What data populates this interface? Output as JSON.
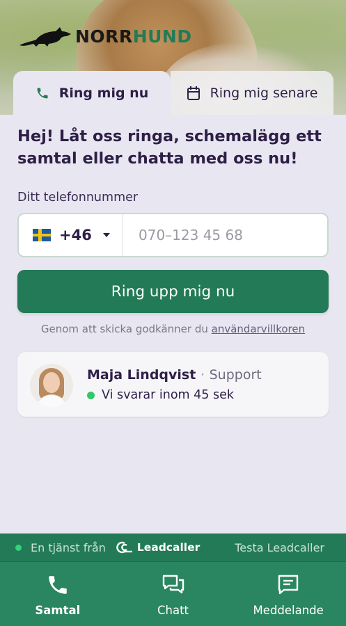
{
  "brand": {
    "name_part1": "NORR",
    "name_part2": "HUND",
    "logo_icon": "fox-icon"
  },
  "tabs": [
    {
      "label": "Ring mig nu",
      "icon": "phone-icon",
      "active": true
    },
    {
      "label": "Ring mig senare",
      "icon": "calendar-icon",
      "active": false
    }
  ],
  "main": {
    "headline": "Hej! Låt oss ringa, schemalägg ett samtal eller chatta med oss nu!",
    "phone_label": "Ditt telefonnummer",
    "country_code": "+46",
    "country_flag": "sweden-flag",
    "phone_placeholder": "070–123 45 68",
    "phone_value": "",
    "cta_label": "Ring upp mig nu",
    "terms_prefix": "Genom att skicka godkänner du",
    "terms_link": "användarvillkoren"
  },
  "agent": {
    "name": "Maja Lindqvist",
    "separator": "·",
    "role": "Support",
    "status": "Vi svarar inom 45 sek",
    "status_color": "#2fc86a"
  },
  "footer_strip": {
    "service_text": "En tjänst från",
    "provider": "Leadcaller",
    "try_link": "Testa Leadcaller"
  },
  "bottom_nav": [
    {
      "label": "Samtal",
      "icon": "phone-icon",
      "active": true
    },
    {
      "label": "Chatt",
      "icon": "chat-icon",
      "active": false
    },
    {
      "label": "Meddelande",
      "icon": "message-icon",
      "active": false
    }
  ],
  "colors": {
    "accent": "#237a57",
    "text": "#2e1f47",
    "background": "#e8e7f1"
  }
}
